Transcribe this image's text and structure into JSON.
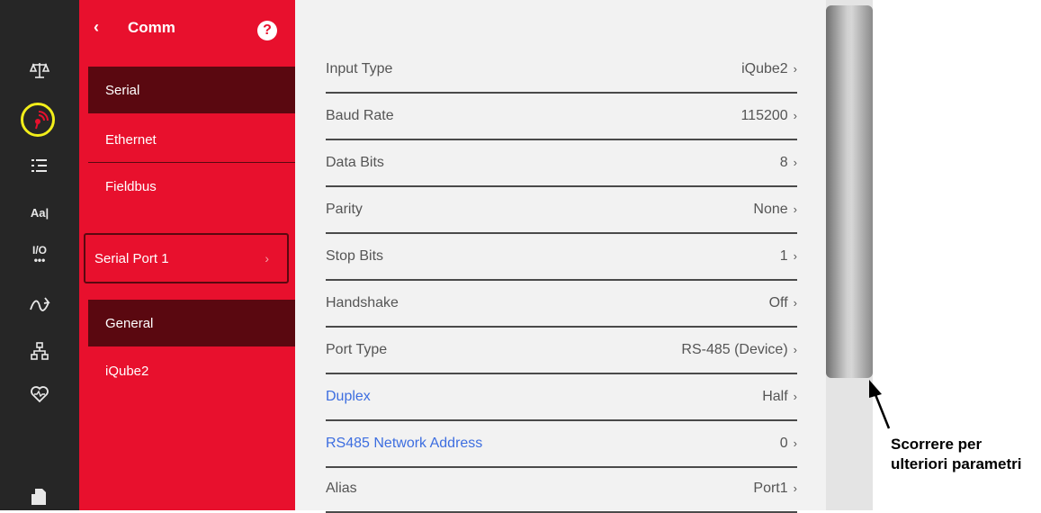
{
  "rail": {
    "icons": [
      "scale-icon",
      "comm-signal-icon",
      "list-icon",
      "text-aa-icon",
      "io-icon",
      "flow-icon",
      "network-icon",
      "health-icon",
      "document-icon"
    ],
    "io_label": "I/O",
    "text_label": "Aa|"
  },
  "nav": {
    "back_label": "‹",
    "title": "Comm",
    "help_label": "?",
    "groups": [
      {
        "items": [
          {
            "label": "Serial",
            "active": true
          },
          {
            "label": "Ethernet",
            "active": false
          },
          {
            "label": "Fieldbus",
            "active": false
          }
        ]
      },
      {
        "items": [
          {
            "label": "Serial Port 1",
            "chevron": "›"
          }
        ]
      },
      {
        "items": [
          {
            "label": "General",
            "active": true
          },
          {
            "label": "iQube2",
            "active": false
          }
        ]
      }
    ]
  },
  "settings": [
    {
      "label": "Input Type",
      "value": "iQube2",
      "link": false
    },
    {
      "label": "Baud Rate",
      "value": "115200",
      "link": false
    },
    {
      "label": "Data Bits",
      "value": "8",
      "link": false
    },
    {
      "label": "Parity",
      "value": "None",
      "link": false
    },
    {
      "label": "Stop Bits",
      "value": "1",
      "link": false
    },
    {
      "label": "Handshake",
      "value": "Off",
      "link": false
    },
    {
      "label": "Port Type",
      "value": "RS-485 (Device)",
      "link": false
    },
    {
      "label": "Duplex",
      "value": "Half",
      "link": true
    },
    {
      "label": "RS485 Network Address",
      "value": "0",
      "link": true
    },
    {
      "label": "Alias",
      "value": "Port1",
      "link": false
    }
  ],
  "chevron": "›",
  "annotation": {
    "line1": "Scorrere per",
    "line2": "ulteriori parametri"
  },
  "colors": {
    "rail": "#262626",
    "nav_red": "#e8102d",
    "nav_active": "#5a0810",
    "link_blue": "#3d6ee0",
    "highlight": "#f2ee1a"
  }
}
